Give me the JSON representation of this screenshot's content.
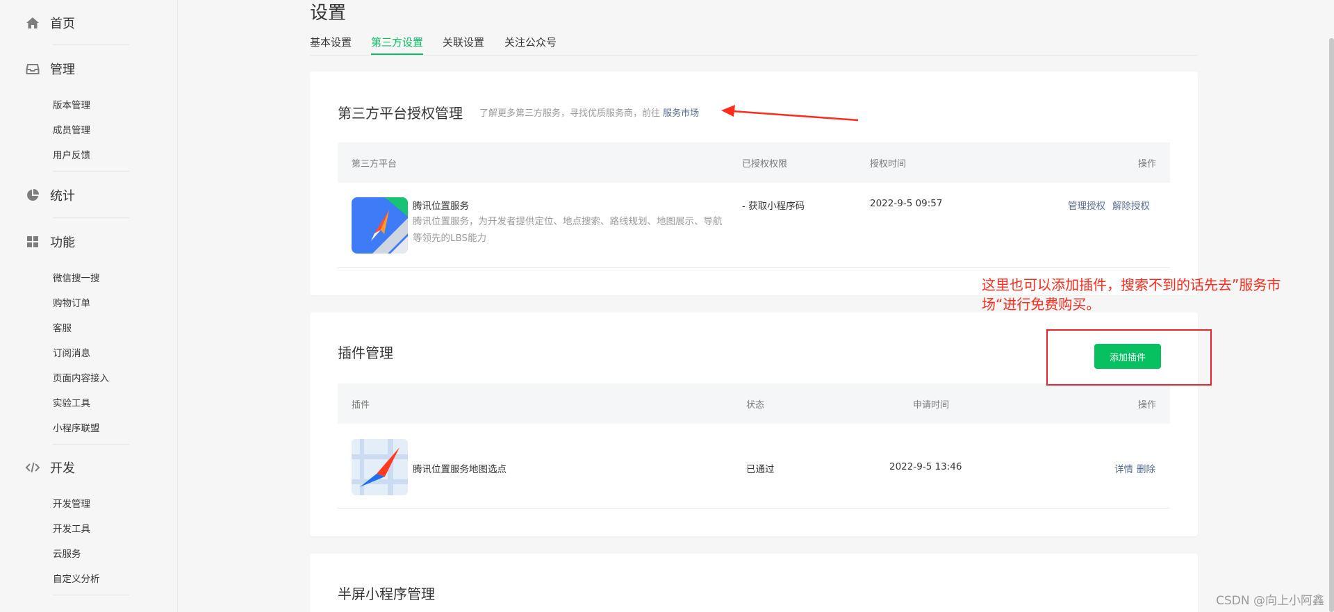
{
  "sidebar": {
    "groups": [
      {
        "label": "首页",
        "icon": "home-icon"
      },
      {
        "label": "管理",
        "icon": "inbox-icon"
      },
      {
        "label": "统计",
        "icon": "pie-chart-icon"
      },
      {
        "label": "功能",
        "icon": "grid-icon"
      },
      {
        "label": "开发",
        "icon": "code-icon"
      }
    ],
    "manage_items": [
      "版本管理",
      "成员管理",
      "用户反馈"
    ],
    "feature_items": [
      "微信搜一搜",
      "购物订单",
      "客服",
      "订阅消息",
      "页面内容接入",
      "实验工具",
      "小程序联盟"
    ],
    "dev_items": [
      "开发管理",
      "开发工具",
      "云服务",
      "自定义分析"
    ]
  },
  "page": {
    "title": "设置",
    "tabs": [
      "基本设置",
      "第三方设置",
      "关联设置",
      "关注公众号"
    ],
    "active_tab": "第三方设置"
  },
  "third_party": {
    "title": "第三方平台授权管理",
    "subtitle_prefix": "了解更多第三方服务，寻找优质服务商，前往",
    "market_link": "服务市场",
    "columns": [
      "第三方平台",
      "已授权权限",
      "授权时间",
      "操作"
    ],
    "row": {
      "name": "腾讯位置服务",
      "desc": "腾讯位置服务，为开发者提供定位、地点搜索、路线规划、地图展示、导航等领先的LBS能力",
      "permission": "- 获取小程序码",
      "time": "2022-9-5 09:57",
      "actions": [
        "管理授权",
        "解除授权"
      ]
    }
  },
  "plugins": {
    "title": "插件管理",
    "add_button": "添加插件",
    "columns": [
      "插件",
      "状态",
      "申请时间",
      "操作"
    ],
    "row": {
      "name": "腾讯位置服务地图选点",
      "status": "已通过",
      "time": "2022-9-5 13:46",
      "actions": [
        "详情",
        "删除"
      ]
    }
  },
  "half_screen": {
    "title": "半屏小程序管理"
  },
  "annotation": {
    "text": "这里也可以添加插件，搜索不到的话先去”服务市场“进行免费购买。"
  },
  "watermark": "CSDN @向上小阿鑫",
  "colors": {
    "accent": "#07c160",
    "link": "#576b95",
    "annotation": "#ff2a1a"
  }
}
